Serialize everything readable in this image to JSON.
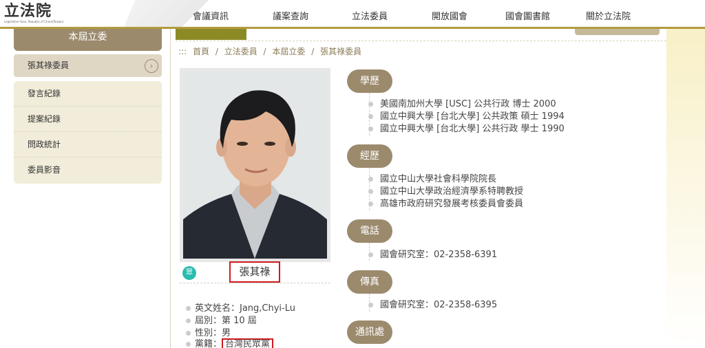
{
  "header": {
    "logo_text": "立法院",
    "logo_subtitle": "Legislative Yuan, Republic of China(Taiwan)",
    "nav": [
      "會議資訊",
      "議案查詢",
      "立法委員",
      "開放國會",
      "國會圖書館",
      "關於立法院"
    ]
  },
  "sidebar": {
    "title": "本屆立委",
    "current": "張其祿委員",
    "items": [
      "發言紀錄",
      "提案紀錄",
      "問政統計",
      "委員影音"
    ]
  },
  "breadcrumb": {
    "prefix": ":::",
    "items": [
      "首頁",
      "立法委員",
      "本屆立委",
      "張其祿委員"
    ],
    "separator": "/"
  },
  "profile": {
    "party_badge": "眾",
    "name": "張其祿",
    "english_name": "英文姓名：Jang,Chyi-Lu",
    "session": "屆別：第 10 屆",
    "gender": "性別：男",
    "party_label": "黨籍：",
    "party": "台灣民眾黨"
  },
  "sections": {
    "education": {
      "title": "學歷",
      "items": [
        "美國南加州大學 [USC] 公共行政 博士 2000",
        "國立中興大學 [台北大學] 公共政策 碩士 1994",
        "國立中興大學 [台北大學] 公共行政 學士 1990"
      ]
    },
    "experience": {
      "title": "經歷",
      "items": [
        "國立中山大學社會科學院院長",
        "國立中山大學政治經濟學系特聘教授",
        "高雄市政府研究發展考核委員會委員"
      ]
    },
    "phone": {
      "title": "電話",
      "items": [
        "國會研究室：02-2358-6391"
      ]
    },
    "fax": {
      "title": "傳真",
      "items": [
        "國會研究室：02-2358-6395"
      ]
    },
    "address": {
      "title": "通訊處"
    }
  },
  "colors": {
    "accent": "#9c8a6d",
    "gold_line": "#b29a3e",
    "highlight_red": "#d0191c",
    "party_badge": "#2bbcb0"
  }
}
